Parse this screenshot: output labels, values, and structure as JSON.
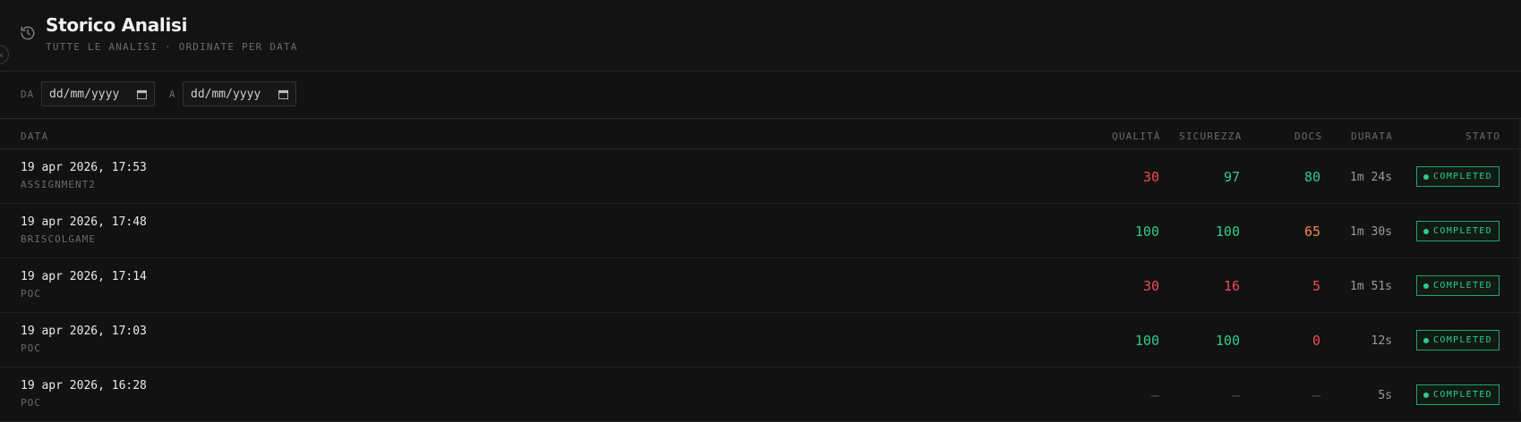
{
  "header": {
    "title": "Storico Analisi",
    "subtitle": "TUTTE LE ANALISI · ORDINATE PER DATA",
    "collapse_glyph": "‹"
  },
  "filters": {
    "from_label": "DA",
    "from_value": "dd/mm/yyyy",
    "to_label": "A",
    "to_value": "dd/mm/yyyy"
  },
  "columns": {
    "data": "DATA",
    "quality": "QUALITÀ",
    "security": "SICUREZZA",
    "docs": "DOCS",
    "duration": "DURATA",
    "status": "STATO"
  },
  "rows": [
    {
      "date": "19 apr 2026, 17:53",
      "repo": "ASSIGNMENT2",
      "quality": "30",
      "quality_color": "red",
      "security": "97",
      "security_color": "green",
      "docs": "80",
      "docs_color": "green",
      "duration": "1m 24s",
      "status": "COMPLETED"
    },
    {
      "date": "19 apr 2026, 17:48",
      "repo": "BRISCOLGAME",
      "quality": "100",
      "quality_color": "green",
      "security": "100",
      "security_color": "green",
      "docs": "65",
      "docs_color": "orange",
      "duration": "1m 30s",
      "status": "COMPLETED"
    },
    {
      "date": "19 apr 2026, 17:14",
      "repo": "POC",
      "quality": "30",
      "quality_color": "red",
      "security": "16",
      "security_color": "red",
      "docs": "5",
      "docs_color": "red",
      "duration": "1m 51s",
      "status": "COMPLETED"
    },
    {
      "date": "19 apr 2026, 17:03",
      "repo": "POC",
      "quality": "100",
      "quality_color": "green",
      "security": "100",
      "security_color": "green",
      "docs": "0",
      "docs_color": "red",
      "duration": "12s",
      "status": "COMPLETED"
    },
    {
      "date": "19 apr 2026, 16:28",
      "repo": "POC",
      "quality": "–",
      "quality_color": "muted",
      "security": "–",
      "security_color": "muted",
      "docs": "–",
      "docs_color": "muted",
      "duration": "5s",
      "status": "COMPLETED"
    }
  ],
  "colors": {
    "green": "#2ecb8b",
    "red": "#ee4b54",
    "orange": "#f2874a",
    "background": "#121212"
  },
  "icons": {
    "history": "history-icon",
    "calendar": "calendar-icon",
    "status_dot": "status-dot-icon"
  }
}
